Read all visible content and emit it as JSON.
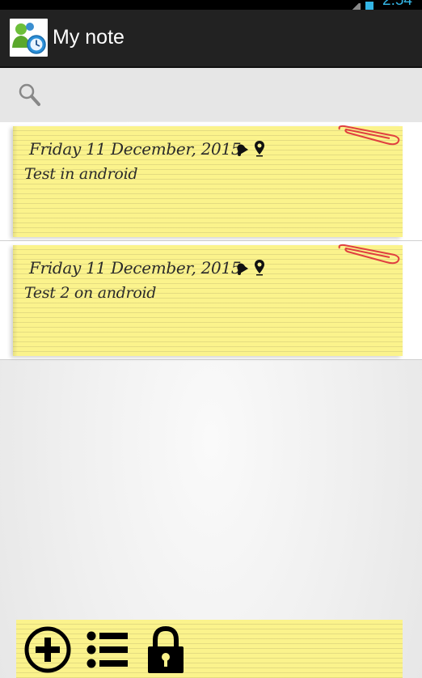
{
  "status_bar": {
    "time": "2:54"
  },
  "action_bar": {
    "title": "My note",
    "app_icon": "app-logo-icon"
  },
  "search": {
    "icon": "search-icon"
  },
  "notes": [
    {
      "date": "Friday 11 December, 2015",
      "text": "Test in android",
      "icons": [
        "alarm-icon",
        "location-pin-icon",
        "paperclip-icon"
      ]
    },
    {
      "date": "Friday 11 December, 2015",
      "text": "Test 2 on android",
      "icons": [
        "alarm-icon",
        "location-pin-icon",
        "paperclip-icon"
      ]
    }
  ],
  "bottom_bar": {
    "buttons": [
      "add-icon",
      "list-icon",
      "lock-icon"
    ]
  },
  "colors": {
    "action_bar": "#222222",
    "note_paper": "#fbf38c",
    "accent": "#33b5e5",
    "clip": "#e04040"
  }
}
